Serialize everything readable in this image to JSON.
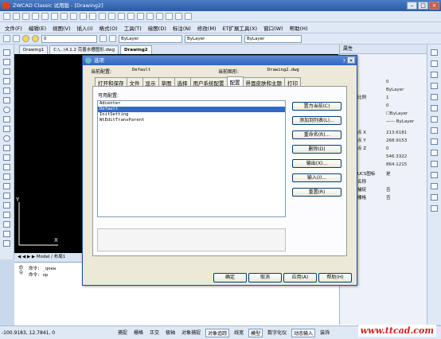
{
  "app": {
    "title": "ZWCAD Classic 试用版 - [Drawing2]",
    "menu": [
      "文件(F)",
      "编辑(E)",
      "视图(V)",
      "插入(I)",
      "格式(O)",
      "工具(T)",
      "绘图(D)",
      "标注(N)",
      "修改(M)",
      "ET扩展工具(X)",
      "窗口(W)",
      "帮助(H)"
    ],
    "layer_value": "0",
    "color_value": "ByLayer",
    "linetype_value": "ByLayer",
    "lineweight_value": "ByLayer"
  },
  "doc_tabs": [
    "Drawing1",
    "C:\\...\\4.1.2 完善水槽图形.dwg",
    "Drawing2"
  ],
  "layout_tabs": "Model / 布局1",
  "command_history": [
    "命令: _qnew",
    "命令: op"
  ],
  "command_label": "命令",
  "properties": {
    "title": "属性",
    "rows": [
      {
        "k": "",
        "v": "0"
      },
      {
        "k": "",
        "v": "ByLayer"
      },
      {
        "k": "比例",
        "v": "1"
      },
      {
        "k": "",
        "v": "0"
      },
      {
        "k": "",
        "v": "☐ByLayer"
      },
      {
        "k": "",
        "v": "—— ByLayer"
      },
      {
        "k": "点 X",
        "v": "213.6181"
      },
      {
        "k": "点 Y",
        "v": "268.9153"
      },
      {
        "k": "点 Z",
        "v": "0"
      },
      {
        "k": "",
        "v": "546.3322"
      },
      {
        "k": "",
        "v": "864.1215"
      },
      {
        "k": "UCS图标",
        "v": "是"
      },
      {
        "k": "名称",
        "v": ""
      },
      {
        "k": "捕捉",
        "v": "否"
      },
      {
        "k": "栅格",
        "v": "否"
      }
    ]
  },
  "status": {
    "coords": "-100.9183,  12.7841,  0",
    "buttons": [
      "捕捉",
      "栅格",
      "正交",
      "极轴",
      "对象捕捉",
      "对象追踪",
      "线宽",
      "模型",
      "数字化仪",
      "动态输入",
      "装饰"
    ],
    "watermark": "www.ttcad.com"
  },
  "dialog": {
    "title": "选项",
    "help": "?",
    "current_config_label": "当前配置:",
    "current_config_value": "Default",
    "current_drawing_label": "当前图形:",
    "current_drawing_value": "Drawing2.dwg",
    "tabs": [
      "打开和保存",
      "文件",
      "显示",
      "草图",
      "选择",
      "用户系统配置",
      "配置",
      "界面皮肤和主题",
      "打印"
    ],
    "active_tab": "配置",
    "list_label": "可用配置:",
    "profiles": [
      "Adcenter",
      "Default",
      "InitSetting",
      "WtEditTransParent"
    ],
    "selected_profile": "Default",
    "side_buttons": [
      "置为当前(C)",
      "添加到列表(L)...",
      "重命名(R)...",
      "删除(D)",
      "输出(X)...",
      "输入(I)...",
      "重置(R)"
    ],
    "footer_buttons": [
      "确定",
      "取消",
      "应用(A)",
      "帮助(H)"
    ]
  }
}
